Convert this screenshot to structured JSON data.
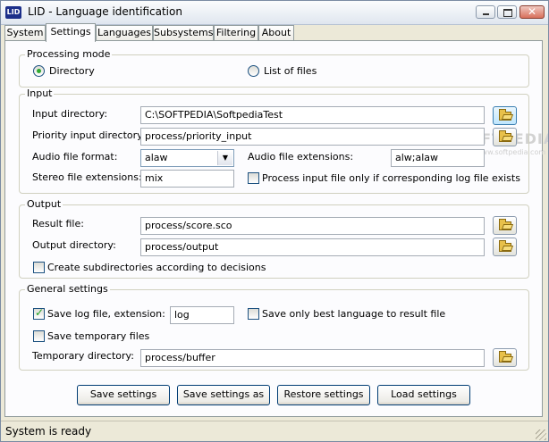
{
  "window": {
    "app_icon_text": "LID",
    "title": "LID - Language identification",
    "minimize_glyph": "",
    "maximize_glyph": "",
    "close_glyph": "✕"
  },
  "tabs": [
    "System",
    "Settings",
    "Languages",
    "Subsystems",
    "Filtering",
    "About"
  ],
  "active_tab": "Settings",
  "processing_mode": {
    "title": "Processing mode",
    "options": [
      "Directory",
      "List of files"
    ],
    "selected": "Directory"
  },
  "input": {
    "title": "Input",
    "input_directory_label": "Input directory:",
    "input_directory_value": "C:\\SOFTPEDIA\\SoftpediaTest",
    "priority_input_directory_label": "Priority input directory:",
    "priority_input_directory_value": "process/priority_input",
    "audio_file_format_label": "Audio file format:",
    "audio_file_format_value": "alaw",
    "audio_file_extensions_label": "Audio file extensions:",
    "audio_file_extensions_value": "alw;alaw",
    "stereo_file_extensions_label": "Stereo file extensions:",
    "stereo_file_extensions_value": "mix",
    "process_only_with_log_label": "Process input file only if corresponding log file exists",
    "process_only_with_log_checked": false
  },
  "output": {
    "title": "Output",
    "result_file_label": "Result file:",
    "result_file_value": "process/score.sco",
    "output_directory_label": "Output directory:",
    "output_directory_value": "process/output",
    "create_subdirs_label": "Create subdirectories according to decisions",
    "create_subdirs_checked": false
  },
  "general": {
    "title": "General settings",
    "save_log_label": "Save log file, extension:",
    "save_log_checked": true,
    "log_extension_value": "log",
    "save_best_only_label": "Save only best language to result file",
    "save_best_only_checked": false,
    "save_temp_label": "Save temporary files",
    "save_temp_checked": false,
    "temp_directory_label": "Temporary directory:",
    "temp_directory_value": "process/buffer"
  },
  "buttons": {
    "save_settings": "Save settings",
    "save_settings_as": "Save settings as",
    "restore_settings": "Restore settings",
    "load_settings": "Load settings"
  },
  "status": "System is ready",
  "watermark": {
    "main": "SOFTPEDIA",
    "sub": "www.softpedia.com"
  }
}
